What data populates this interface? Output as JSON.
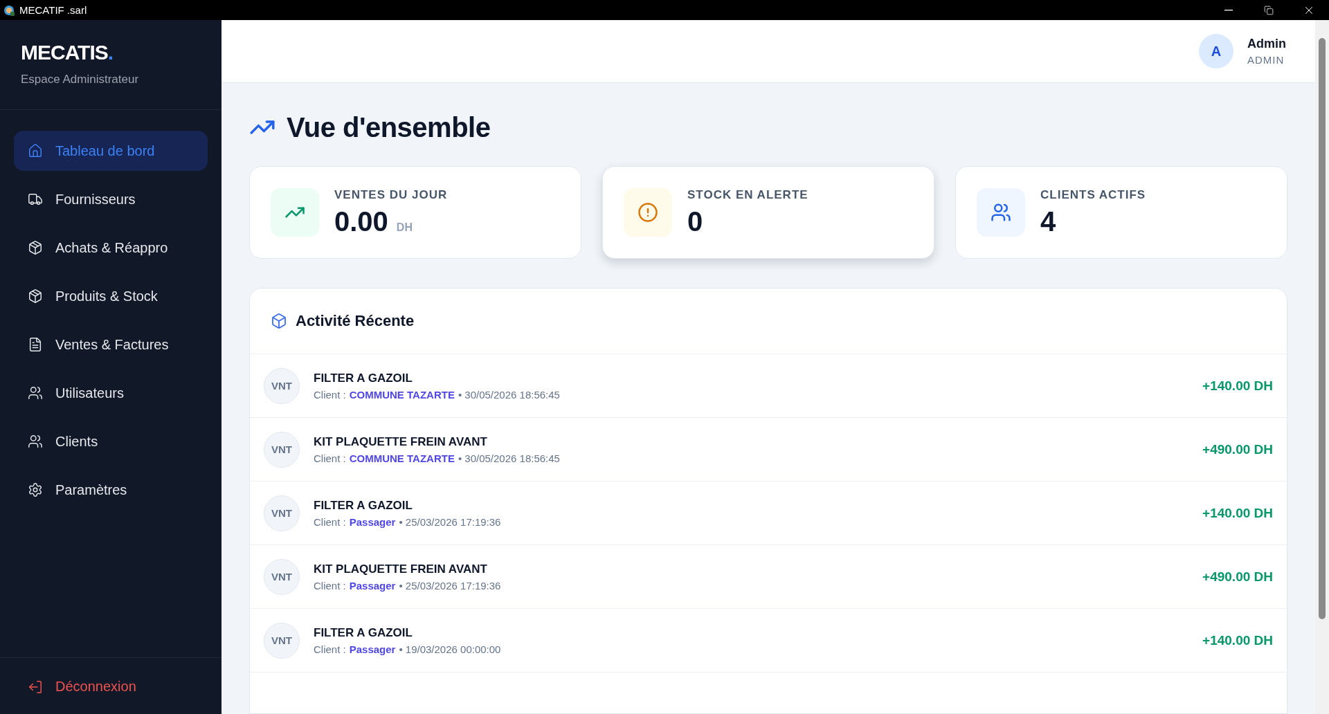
{
  "window": {
    "title": "MECATIF .sarl"
  },
  "sidebar": {
    "brand": "MECATIS",
    "brand_dot": ".",
    "subtitle": "Espace Administrateur",
    "items": [
      {
        "label": "Tableau de bord",
        "kind": "home",
        "selected": true
      },
      {
        "label": "Fournisseurs",
        "kind": "truck",
        "selected": false
      },
      {
        "label": "Achats & Réappro",
        "kind": "package",
        "selected": false
      },
      {
        "label": "Produits & Stock",
        "kind": "package",
        "selected": false
      },
      {
        "label": "Ventes & Factures",
        "kind": "file",
        "selected": false
      },
      {
        "label": "Utilisateurs",
        "kind": "users",
        "selected": false
      },
      {
        "label": "Clients",
        "kind": "user",
        "selected": false
      },
      {
        "label": "Paramètres",
        "kind": "settings",
        "selected": false
      }
    ],
    "logout": "Déconnexion"
  },
  "header": {
    "avatar": "A",
    "user_name": "Admin",
    "role": "ADMIN"
  },
  "page_title": "Vue d'ensemble",
  "stats": [
    {
      "kind": "sales",
      "label": "VENTES DU JOUR",
      "value": "0.00",
      "unit": "DH",
      "elevated": false
    },
    {
      "kind": "alert",
      "label": "STOCK EN ALERTE",
      "value": "0",
      "elevated": true
    },
    {
      "kind": "clients",
      "label": "CLIENTS ACTIFS",
      "value": "4",
      "elevated": false
    }
  ],
  "activity": {
    "title": "Activité Récente",
    "rows": [
      {
        "badge": "VNT",
        "product": "FILTER A GAZOIL",
        "client_label": "Client :",
        "client": "COMMUNE TAZARTE",
        "date": "• 30/05/2026 18:56:45",
        "amount": "+140.00 DH"
      },
      {
        "badge": "VNT",
        "product": "KIT PLAQUETTE FREIN AVANT",
        "client_label": "Client :",
        "client": "COMMUNE TAZARTE",
        "date": "• 30/05/2026 18:56:45",
        "amount": "+490.00 DH"
      },
      {
        "badge": "VNT",
        "product": "FILTER A GAZOIL",
        "client_label": "Client :",
        "client": "Passager",
        "date": "• 25/03/2026 17:19:36",
        "amount": "+140.00 DH"
      },
      {
        "badge": "VNT",
        "product": "KIT PLAQUETTE FREIN AVANT",
        "client_label": "Client :",
        "client": "Passager",
        "date": "• 25/03/2026 17:19:36",
        "amount": "+490.00 DH"
      },
      {
        "badge": "VNT",
        "product": "FILTER A GAZOIL",
        "client_label": "Client :",
        "client": "Passager",
        "date": "• 19/03/2026 00:00:00",
        "amount": "+140.00 DH"
      }
    ]
  }
}
